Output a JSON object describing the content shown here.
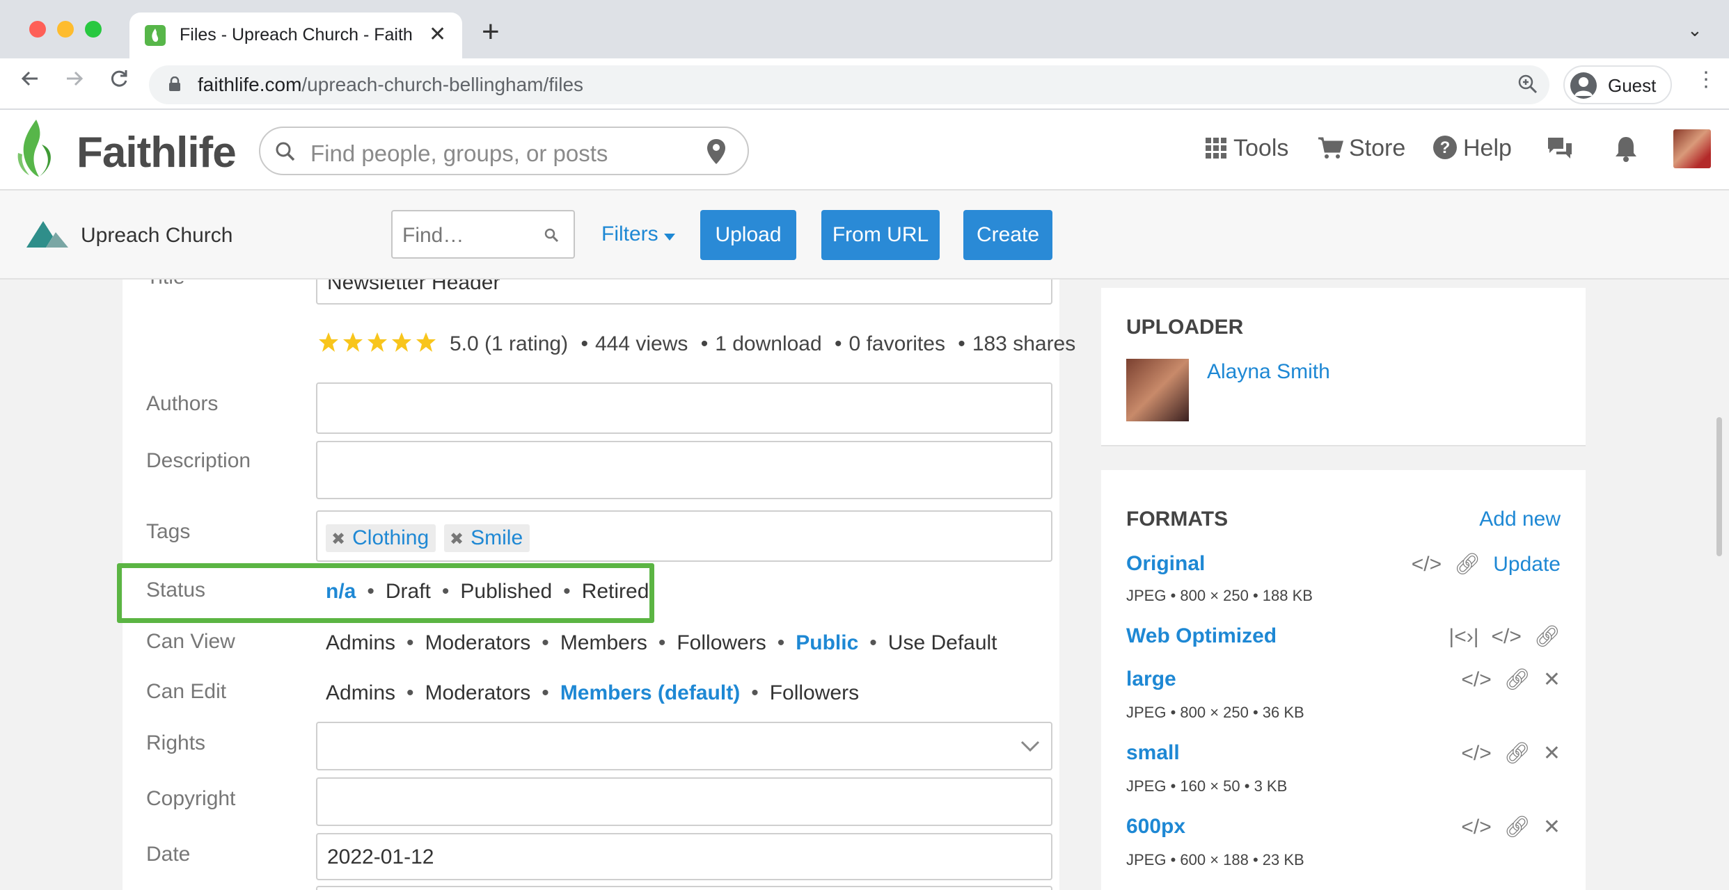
{
  "browser": {
    "tab_title": "Files - Upreach Church - Faithlife",
    "url_domain": "faithlife.com",
    "url_path": "/upreach-church-bellingham/files",
    "profile_label": "Guest"
  },
  "header": {
    "logo_text": "Faithlife",
    "search_placeholder": "Find people, groups, or posts",
    "tools_label": "Tools",
    "store_label": "Store",
    "help_label": "Help"
  },
  "subheader": {
    "church_name": "Upreach Church",
    "find_placeholder": "Find…",
    "filters_label": "Filters",
    "upload_label": "Upload",
    "from_url_label": "From URL",
    "create_label": "Create"
  },
  "form": {
    "title_label": "Title",
    "title_value": "Newsletter Header",
    "rating_value": 5.0,
    "stats": {
      "rating": "5.0 (1 rating)",
      "views": "444 views",
      "downloads": "1 download",
      "favorites": "0 favorites",
      "shares": "183 shares"
    },
    "authors_label": "Authors",
    "description_label": "Description",
    "tags_label": "Tags",
    "tags": [
      "Clothing",
      "Smile"
    ],
    "status_label": "Status",
    "status_options": [
      "n/a",
      "Draft",
      "Published",
      "Retired"
    ],
    "status_selected": "n/a",
    "can_view_label": "Can View",
    "can_view_options": [
      "Admins",
      "Moderators",
      "Members",
      "Followers",
      "Public",
      "Use Default"
    ],
    "can_view_selected": "Public",
    "can_edit_label": "Can Edit",
    "can_edit_options": [
      "Admins",
      "Moderators",
      "Members (default)",
      "Followers"
    ],
    "can_edit_selected": "Members (default)",
    "rights_label": "Rights",
    "copyright_label": "Copyright",
    "date_label": "Date",
    "date_value": "2022-01-12"
  },
  "uploader": {
    "heading": "UPLOADER",
    "name": "Alayna Smith"
  },
  "formats": {
    "heading": "FORMATS",
    "add_new_label": "Add new",
    "update_label": "Update",
    "items": [
      {
        "name": "Original",
        "meta": "JPEG • 800 × 250 • 188 KB"
      },
      {
        "name": "Web Optimized",
        "meta": ""
      },
      {
        "name": "large",
        "meta": "JPEG • 800 × 250 • 36 KB"
      },
      {
        "name": "small",
        "meta": "JPEG • 160 × 50 • 3 KB"
      },
      {
        "name": "600px",
        "meta": "JPEG • 600 × 188 • 23 KB"
      }
    ]
  },
  "colors": {
    "link_blue": "#1e88d4",
    "button_blue": "#2a8ad6",
    "highlight_green": "#5bb543",
    "brand_green": "#57b649"
  }
}
